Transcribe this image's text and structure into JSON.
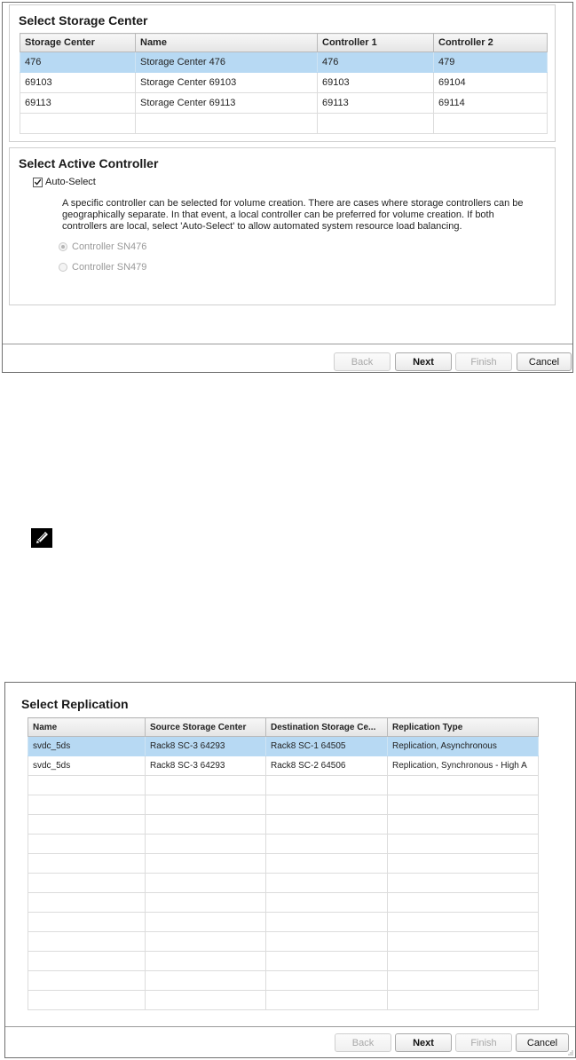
{
  "dialog1": {
    "storage": {
      "title": "Select Storage Center",
      "columns": [
        "Storage Center",
        "Name",
        "Controller 1",
        "Controller 2"
      ],
      "rows": [
        [
          "476",
          "Storage Center 476",
          "476",
          "479"
        ],
        [
          "69103",
          "Storage Center 69103",
          "69103",
          "69104"
        ],
        [
          "69113",
          "Storage Center 69113",
          "69113",
          "69114"
        ],
        [
          "",
          "",
          "",
          ""
        ]
      ],
      "selected_row": 0
    },
    "controller": {
      "title": "Select Active Controller",
      "auto_select_label": "Auto-Select",
      "auto_select_checked": true,
      "description": "A specific controller can be selected for volume creation. There are cases where storage controllers can be geographically separate. In that event, a local controller can be preferred for volume creation. If both controllers are local, select 'Auto-Select' to allow automated system resource load balancing.",
      "options": [
        "Controller SN476",
        "Controller SN479"
      ]
    },
    "buttons": {
      "back": "Back",
      "next": "Next",
      "finish": "Finish",
      "cancel": "Cancel"
    }
  },
  "note_icon": "pencil-note-icon",
  "dialog2": {
    "replication": {
      "title": "Select Replication",
      "columns": [
        "Name",
        "Source Storage Center",
        "Destination Storage Ce...",
        "Replication Type"
      ],
      "rows": [
        [
          "svdc_5ds",
          "Rack8 SC-3 64293",
          "Rack8 SC-1 64505",
          "Replication, Asynchronous"
        ],
        [
          "svdc_5ds",
          "Rack8 SC-3 64293",
          "Rack8 SC-2 64506",
          "Replication, Synchronous - High A"
        ],
        [
          "",
          "",
          "",
          ""
        ],
        [
          "",
          "",
          "",
          ""
        ],
        [
          "",
          "",
          "",
          ""
        ],
        [
          "",
          "",
          "",
          ""
        ],
        [
          "",
          "",
          "",
          ""
        ],
        [
          "",
          "",
          "",
          ""
        ],
        [
          "",
          "",
          "",
          ""
        ],
        [
          "",
          "",
          "",
          ""
        ],
        [
          "",
          "",
          "",
          ""
        ],
        [
          "",
          "",
          "",
          ""
        ],
        [
          "",
          "",
          "",
          ""
        ],
        [
          "",
          "",
          "",
          ""
        ]
      ],
      "selected_row": 0
    },
    "buttons": {
      "back": "Back",
      "next": "Next",
      "finish": "Finish",
      "cancel": "Cancel"
    }
  }
}
